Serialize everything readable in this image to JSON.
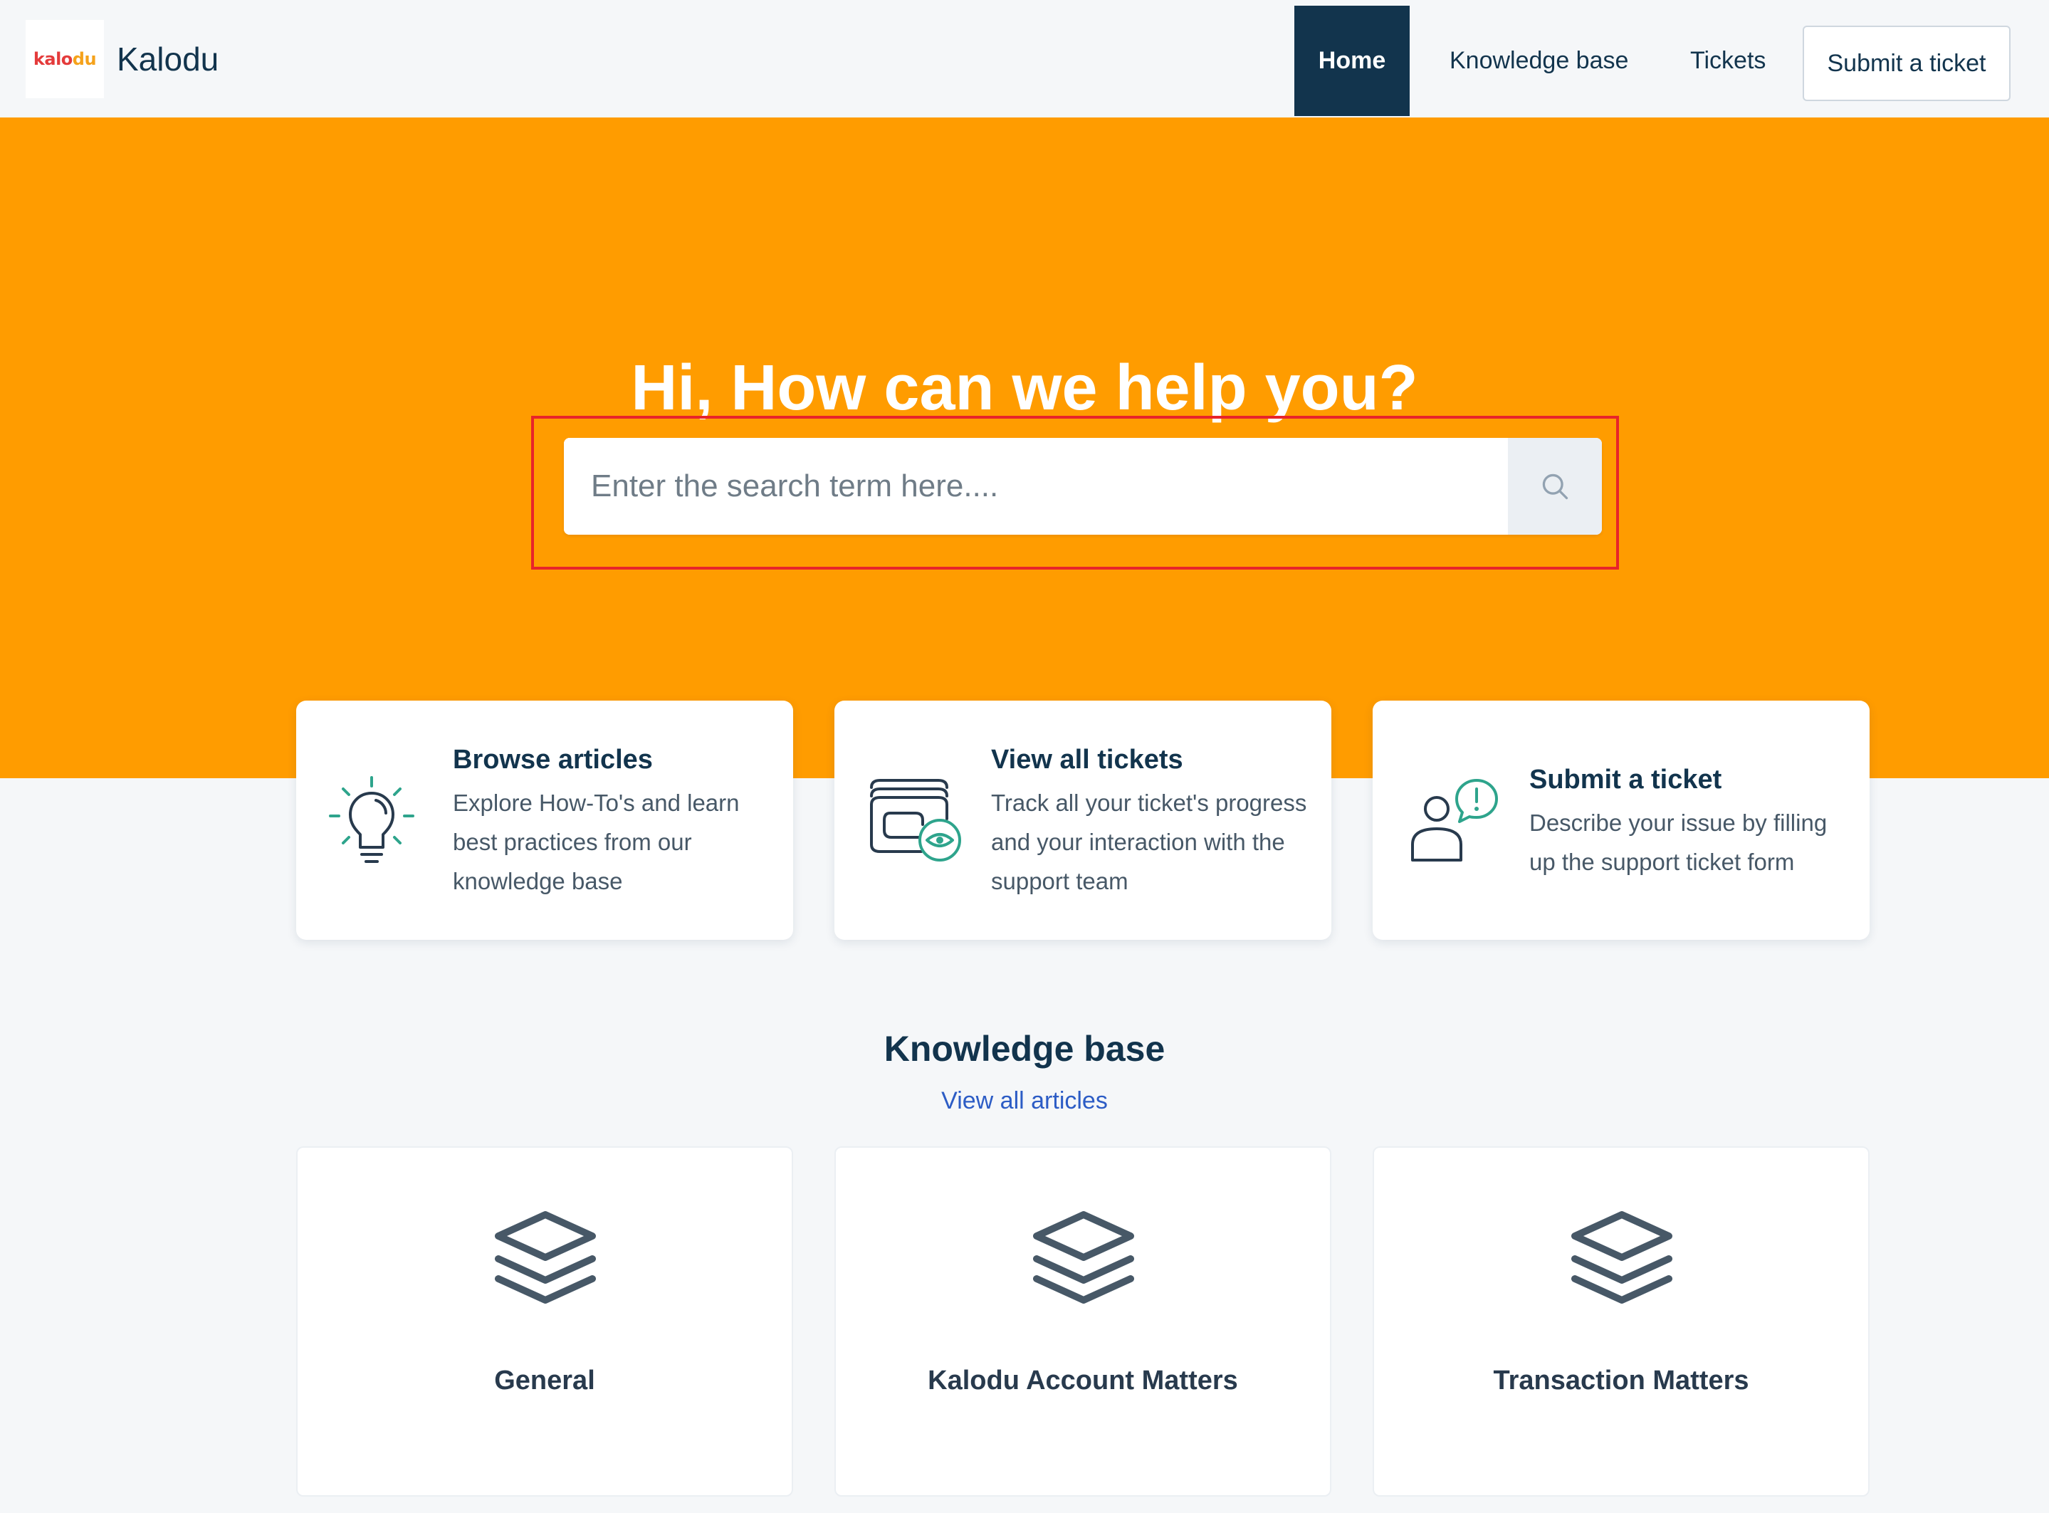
{
  "header": {
    "logo_text_a": "kalo",
    "logo_text_b": "du",
    "brand_name": "Kalodu",
    "nav": {
      "home": "Home",
      "knowledge_base": "Knowledge base",
      "tickets": "Tickets",
      "submit_ticket": "Submit a ticket"
    }
  },
  "hero": {
    "title": "Hi, How can we help you?",
    "search": {
      "placeholder": "Enter the search term here....",
      "value": "",
      "button_icon": "search-icon"
    }
  },
  "actions": [
    {
      "icon": "lightbulb-icon",
      "title": "Browse articles",
      "description": "Explore How-To's and learn best practices from our knowledge base"
    },
    {
      "icon": "view-tickets-icon",
      "title": "View all tickets",
      "description": "Track all your ticket's progress and your interaction with the support team"
    },
    {
      "icon": "submit-ticket-icon",
      "title": "Submit a ticket",
      "description": "Describe your issue by filling up the support ticket form"
    }
  ],
  "knowledge_base": {
    "title": "Knowledge base",
    "view_all": "View all articles",
    "categories": [
      {
        "icon": "layers-icon",
        "label": "General"
      },
      {
        "icon": "layers-icon",
        "label": "Kalodu Account Matters"
      },
      {
        "icon": "layers-icon",
        "label": "Transaction Matters"
      }
    ]
  },
  "colors": {
    "hero_background": "#ff9c00",
    "nav_active": "#12344d",
    "icon_accent": "#2ea48c",
    "link": "#2c5cc5",
    "highlight_box": "#e8242a"
  }
}
